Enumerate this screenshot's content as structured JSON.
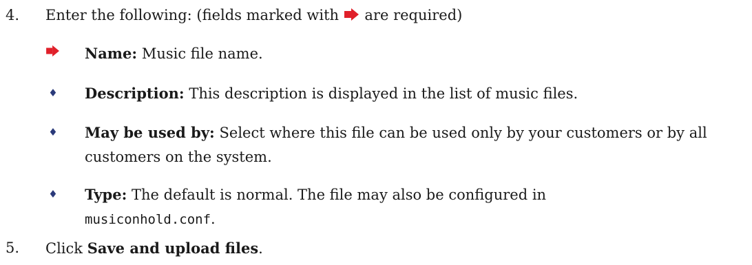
{
  "steps": {
    "step4": {
      "number": "4.",
      "text_before": "Enter the following: (fields marked with",
      "text_after": "are required)"
    },
    "step5": {
      "number": "5.",
      "text_before": "Click",
      "bold": "Save and upload files",
      "text_after": "."
    }
  },
  "fields": [
    {
      "marker": "arrow-icon",
      "label": "Name:",
      "text": "Music file name."
    },
    {
      "marker": "diamond-icon",
      "label": "Description:",
      "text": "This description is displayed in the list of music files."
    },
    {
      "marker": "diamond-icon",
      "label": "May be used by:",
      "text": "Select where this file can be used only by your customers or by all customers on the system."
    },
    {
      "marker": "diamond-icon",
      "label": "Type:",
      "text": "The default is normal. The file may also be configured in",
      "code": "musiconhold.conf",
      "text_after": "."
    }
  ],
  "colors": {
    "arrow": "#e0202a",
    "diamond": "#2a3a7a",
    "text": "#1a1a1a"
  }
}
